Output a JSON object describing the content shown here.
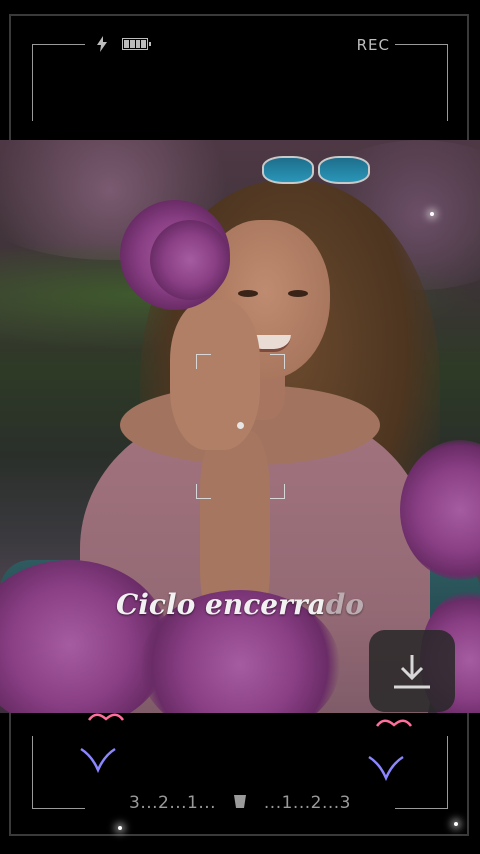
{
  "status": {
    "charge_icon": "lightning-bolt-icon",
    "battery_icon": "battery-full-icon",
    "rec_label": "REC"
  },
  "caption": {
    "text_main": "Ciclo encerra",
    "text_fade": "do"
  },
  "download": {
    "icon": "download-icon"
  },
  "countdown": {
    "left": "3...2...1...",
    "right": "...1...2...3",
    "icon": "trash-icon"
  },
  "colors": {
    "heart_pink": "#ff6f9c",
    "chevron_blue": "#8c87ff",
    "frame": "#9a9a9a"
  }
}
